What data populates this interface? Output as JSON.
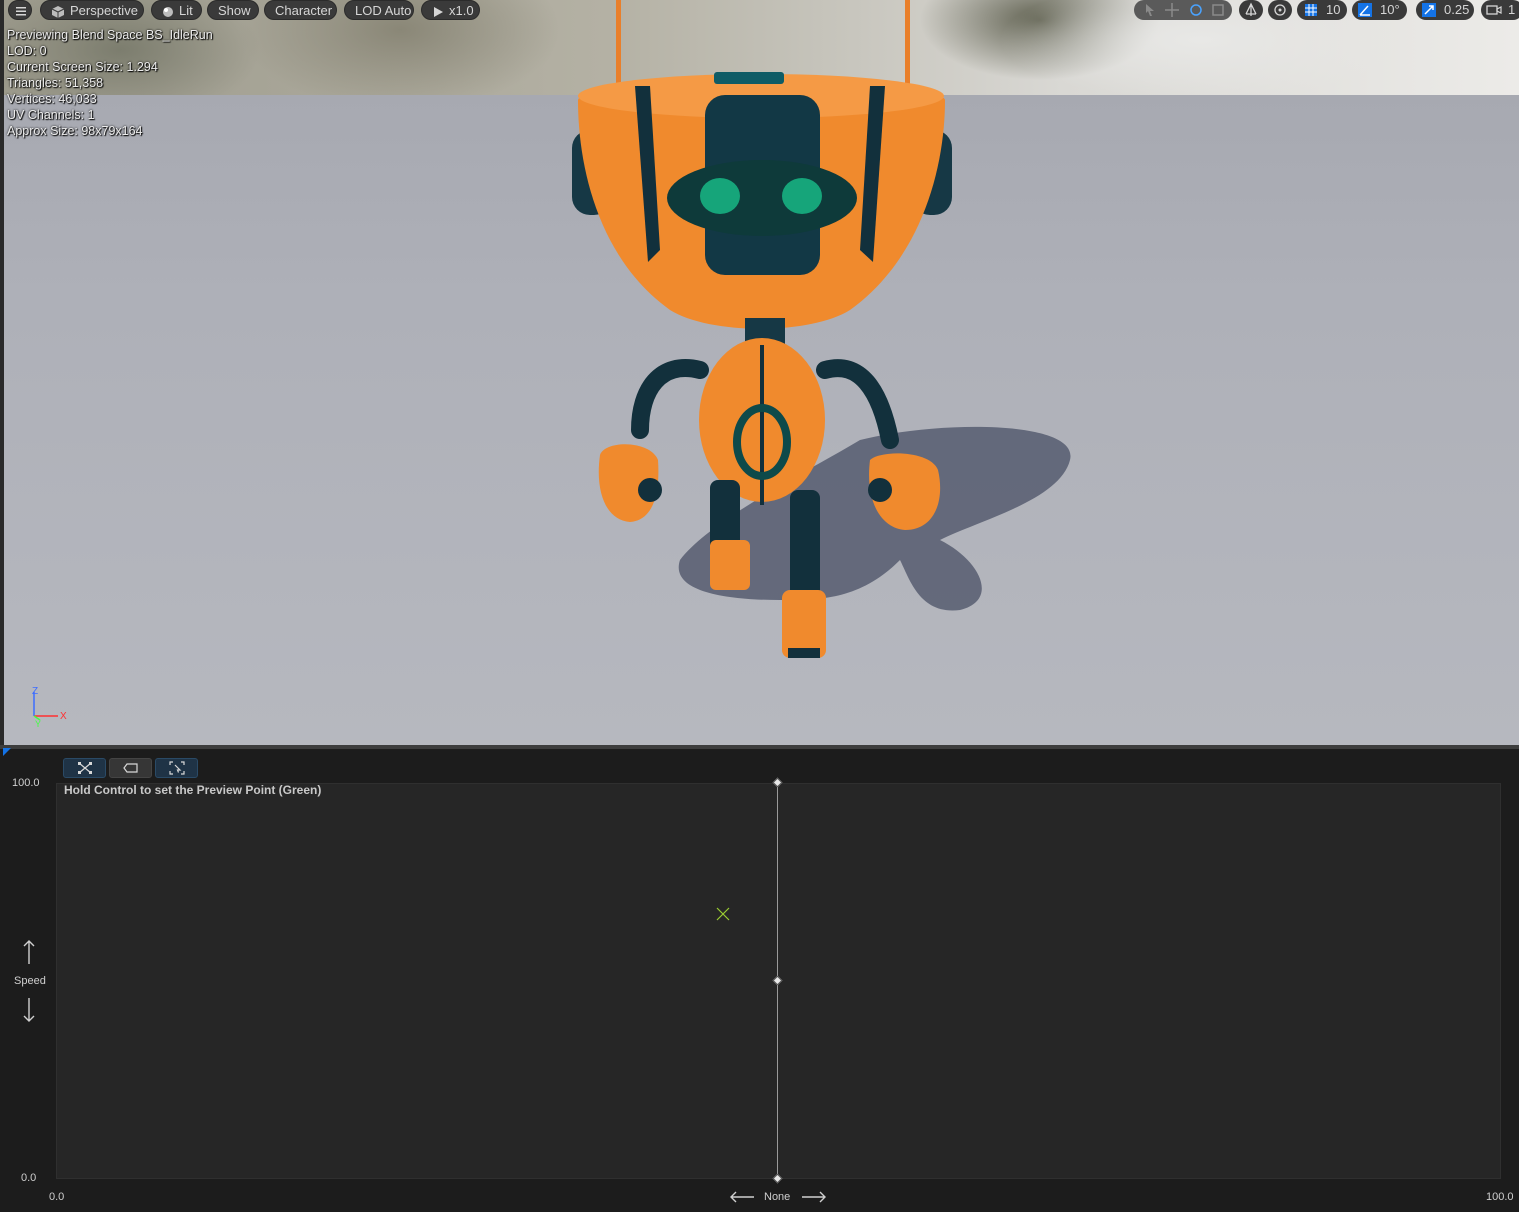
{
  "viewport": {
    "toolbar_left": {
      "menu_icon": "hamburger-menu-icon",
      "perspective_label": "Perspective",
      "lit_label": "Lit",
      "show_label": "Show",
      "character_label": "Character",
      "lod_label": "LOD Auto",
      "playback_label": "x1.0"
    },
    "toolbar_right": {
      "grid_snap_value": "10",
      "rotation_snap_value": "10°",
      "scale_snap_value": "0.25",
      "camera_speed_value": "1"
    },
    "stats": [
      "Previewing Blend Space BS_IdleRun",
      "LOD: 0",
      "Current Screen Size: 1.294",
      "Triangles: 51,358",
      "Vertices: 46,033",
      "UV Channels: 1",
      "Approx Size: 98x79x164"
    ],
    "axis_labels": {
      "z": "Z",
      "x": "X",
      "y": "Y"
    },
    "colors": {
      "robot_orange": "#f28a2e",
      "robot_teal": "#0d3a48",
      "eye_green": "#16a57a"
    }
  },
  "blendspace": {
    "hint": "Hold Control to set the Preview Point (Green)",
    "y_axis": {
      "name": "Speed",
      "max_label": "100.0",
      "min_label": "0.0"
    },
    "x_axis": {
      "name": "None",
      "min_label": "0.0",
      "max_label": "100.0"
    },
    "tool_icons": [
      "grid-snap-icon",
      "triangulation-toggle-icon",
      "fit-view-icon"
    ],
    "preview_point_color": "#9acd32",
    "accent": "#1473e6"
  }
}
